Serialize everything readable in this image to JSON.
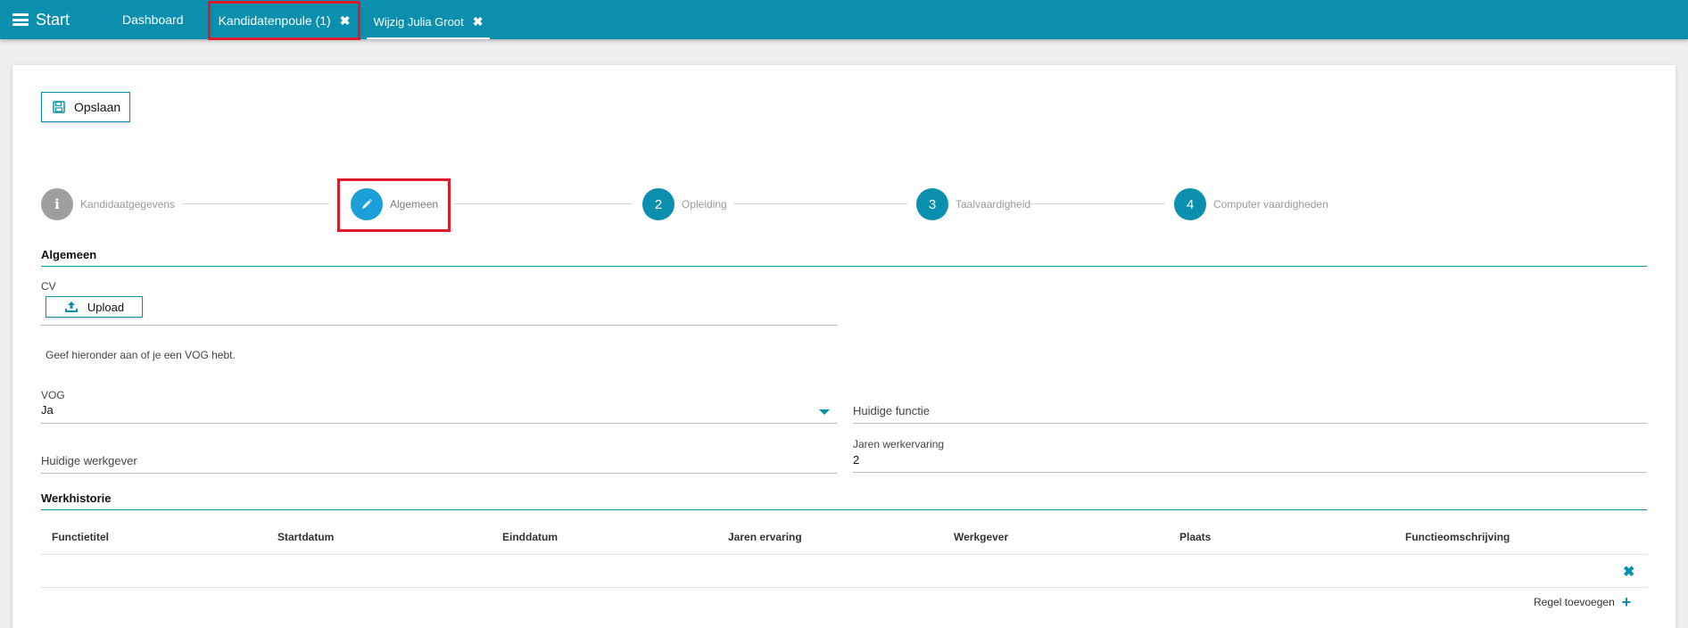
{
  "topbar": {
    "menu_label": "Start",
    "tabs": [
      {
        "label": "Dashboard"
      },
      {
        "label": "Kandidatenpoule (1)"
      },
      {
        "label": "Wijzig Julia Groot"
      }
    ],
    "close_glyph": "✖"
  },
  "toolbar": {
    "save_label": "Opslaan"
  },
  "stepper": {
    "steps": [
      {
        "badge": "i",
        "label": "Kandidaatgegevens"
      },
      {
        "badge": "",
        "label": "Algemeen"
      },
      {
        "badge": "2",
        "label": "Opleiding"
      },
      {
        "badge": "3",
        "label": "Taalvaardigheid"
      },
      {
        "badge": "4",
        "label": "Computer vaardigheden"
      }
    ]
  },
  "algemeen": {
    "title": "Algemeen",
    "cv_label": "CV",
    "upload_label": "Upload",
    "hint": "Geef hieronder aan of je een VOG hebt.",
    "vog_label": "VOG",
    "vog_value": "Ja",
    "huidige_functie_label": "Huidige functie",
    "huidige_werkgever_label": "Huidige werkgever",
    "jaren_werkervaring_label": "Jaren werkervaring",
    "jaren_werkervaring_value": "2"
  },
  "werkhistorie": {
    "title": "Werkhistorie",
    "columns": [
      "Functietitel",
      "Startdatum",
      "Einddatum",
      "Jaren ervaring",
      "Werkgever",
      "Plaats",
      "Functieomschrijving"
    ],
    "delete_glyph": "✖",
    "add_label": "Regel toevoegen",
    "add_glyph": "+"
  },
  "colors": {
    "accent": "#0a8fae",
    "active_step": "#1a9fd9",
    "highlight": "#e11a2b"
  }
}
